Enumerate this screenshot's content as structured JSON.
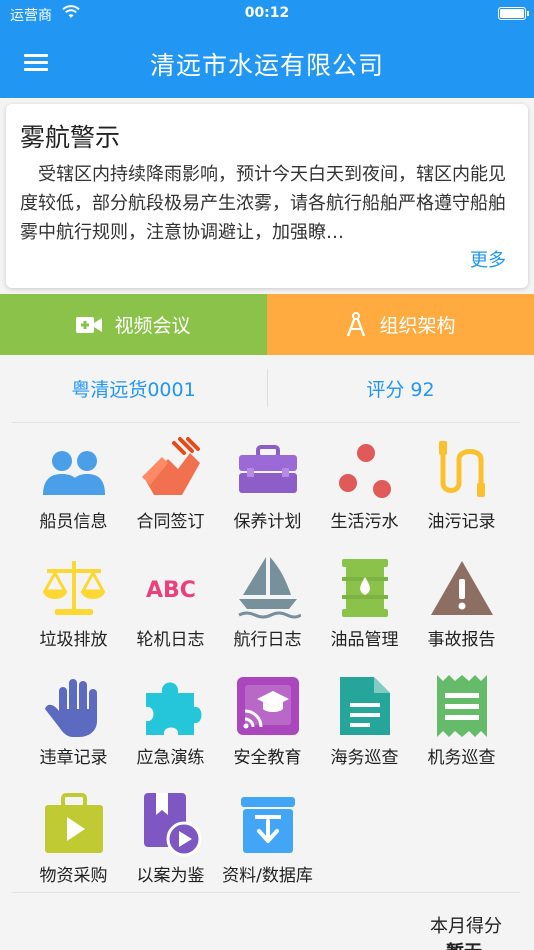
{
  "status": {
    "carrier": "运营商",
    "time": "00:12"
  },
  "header": {
    "title": "清远市水运有限公司"
  },
  "notice": {
    "title": "雾航警示",
    "body": "受辖区内持续降雨影响，预计今天白天到夜间，辖区内能见度较低，部分航段极易产生浓雾，请各航行船舶严格遵守船舶雾中航行规则，注意协调避让，加强瞭…",
    "more": "更多"
  },
  "actions": {
    "video": "视频会议",
    "org": "组织架构"
  },
  "info": {
    "ship": "粤清远货0001",
    "score": "评分 92"
  },
  "grid": [
    {
      "label": "船员信息",
      "icon": "crew-icon"
    },
    {
      "label": "合同签订",
      "icon": "handshake-icon"
    },
    {
      "label": "保养计划",
      "icon": "toolbox-icon"
    },
    {
      "label": "生活污水",
      "icon": "dots-icon"
    },
    {
      "label": "油污记录",
      "icon": "oil-pipe-icon"
    },
    {
      "label": "垃圾排放",
      "icon": "scale-icon"
    },
    {
      "label": "轮机日志",
      "icon": "abc-icon"
    },
    {
      "label": "航行日志",
      "icon": "sailboat-icon"
    },
    {
      "label": "油品管理",
      "icon": "oil-drum-icon"
    },
    {
      "label": "事故报告",
      "icon": "warning-icon"
    },
    {
      "label": "违章记录",
      "icon": "hand-icon"
    },
    {
      "label": "应急演练",
      "icon": "puzzle-icon"
    },
    {
      "label": "安全教育",
      "icon": "cast-education-icon"
    },
    {
      "label": "海务巡查",
      "icon": "document-icon"
    },
    {
      "label": "机务巡查",
      "icon": "receipt-icon"
    },
    {
      "label": "物资采购",
      "icon": "play-bag-icon"
    },
    {
      "label": "以案为鉴",
      "icon": "video-book-icon"
    },
    {
      "label": "资料/数据库",
      "icon": "archive-icon"
    }
  ],
  "monthly": {
    "label": "本月得分",
    "value": "暂无"
  }
}
